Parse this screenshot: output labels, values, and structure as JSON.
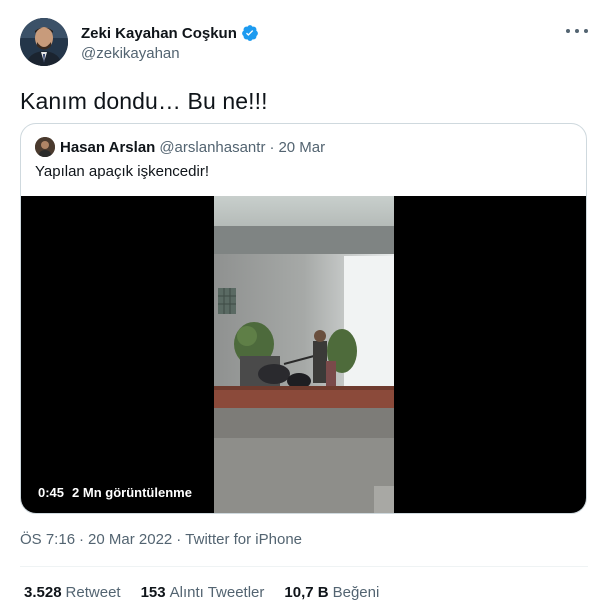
{
  "author": {
    "name": "Zeki Kayahan Coşkun",
    "handle": "@zekikayahan",
    "verified_color": "#1d9bf0"
  },
  "tweet": {
    "text": "Kanım dondu… Bu ne!!!"
  },
  "quote": {
    "name": "Hasan Arslan",
    "handle": "@arslanhasantr",
    "separator": "·",
    "date": "20 Mar",
    "text": "Yapılan apaçık işkencedir!",
    "video": {
      "duration": "0:45",
      "views": "2 Mn görüntülenme"
    }
  },
  "timestamp": {
    "time": "ÖS 7:16",
    "sep1": "·",
    "date": "20 Mar 2022",
    "sep2": "·",
    "source": "Twitter for iPhone"
  },
  "stats": [
    {
      "num": "3.528",
      "label": "Retweet"
    },
    {
      "num": "153",
      "label": "Alıntı Tweetler"
    },
    {
      "num": "10,7 B",
      "label": "Beğeni"
    }
  ],
  "icons": {
    "more": "more-icon",
    "verified": "verified-badge-icon"
  }
}
